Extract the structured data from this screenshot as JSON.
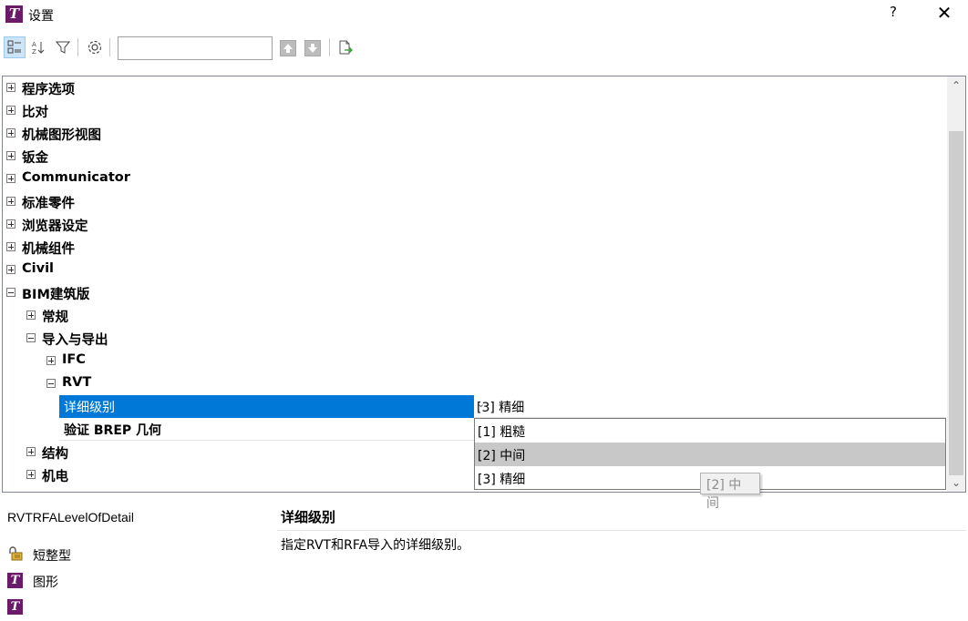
{
  "window": {
    "title": "设置",
    "app_icon_letter": "T",
    "help_label": "?",
    "close_label": "✕"
  },
  "toolbar": {
    "search_value": "",
    "icons": [
      "categorized-view-icon",
      "alphabetical-sort-icon",
      "filter-icon",
      "gear-icon",
      "arrow-up-icon",
      "arrow-down-icon",
      "export-icon"
    ]
  },
  "tree": {
    "top_level": [
      {
        "label": "程序选项",
        "expanded": false
      },
      {
        "label": "比对",
        "expanded": false
      },
      {
        "label": "机械图形视图",
        "expanded": false
      },
      {
        "label": "钣金",
        "expanded": false
      },
      {
        "label": "Communicator",
        "expanded": false
      },
      {
        "label": "标准零件",
        "expanded": false
      },
      {
        "label": "浏览器设定",
        "expanded": false
      },
      {
        "label": "机械组件",
        "expanded": false
      },
      {
        "label": "Civil",
        "expanded": false
      },
      {
        "label": "BIM建筑版",
        "expanded": true
      }
    ],
    "bim_children": [
      {
        "label": "常规",
        "expanded": false
      },
      {
        "label": "导入与导出",
        "expanded": true
      }
    ],
    "import_export_children": [
      {
        "label": "IFC",
        "expanded": false
      },
      {
        "label": "RVT",
        "expanded": true
      }
    ],
    "rvt_props": [
      {
        "name": "详细级别",
        "value": "[3] 精细",
        "selected": true
      },
      {
        "name": "验证 BREP 几何",
        "value": ""
      }
    ],
    "after_children": [
      {
        "label": "结构",
        "expanded": false
      },
      {
        "label": "机电",
        "expanded": false
      }
    ]
  },
  "dropdown": {
    "options": [
      "[1] 粗糙",
      "[2] 中间",
      "[3] 精细"
    ],
    "hovered_index": 1,
    "tooltip": "[2] 中间"
  },
  "info": {
    "internal_name": "RVTRFALevelOfDetail",
    "title": "详细级别",
    "description": "指定RVT和RFA导入的详细级别。",
    "type_label": "短整型",
    "category_label": "图形",
    "third_icon_letter": "T"
  },
  "colors": {
    "selection": "#0078d7",
    "app_brand": "#6a1a68",
    "hover": "#c8c8c8"
  }
}
